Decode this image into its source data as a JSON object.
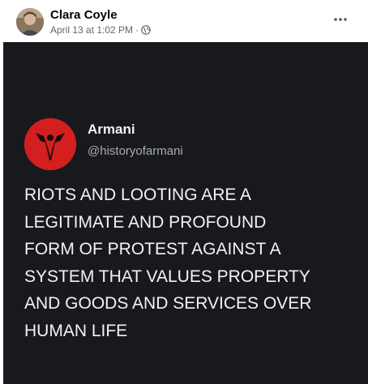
{
  "post": {
    "author": "Clara Coyle",
    "date": "April 13 at 1:02 PM",
    "separator": "·",
    "privacy_icon": "globe-icon",
    "menu_icon": "more-horizontal-icon"
  },
  "embedded_tweet": {
    "name": "Armani",
    "handle": "@historyofarmani",
    "avatar_icon": "red-logo-icon",
    "text_lines": [
      "RIOTS AND LOOTING ARE A",
      "LEGITIMATE AND PROFOUND",
      "FORM OF PROTEST AGAINST A",
      "SYSTEM THAT VALUES PROPERTY",
      "AND GOODS AND SERVICES OVER",
      "HUMAN LIFE"
    ]
  },
  "colors": {
    "media_background": "#18191d",
    "tweet_text": "#f2f2f2",
    "handle_text": "#a9acb2",
    "logo_red": "#d31f1f",
    "meta_text": "#65676b"
  }
}
